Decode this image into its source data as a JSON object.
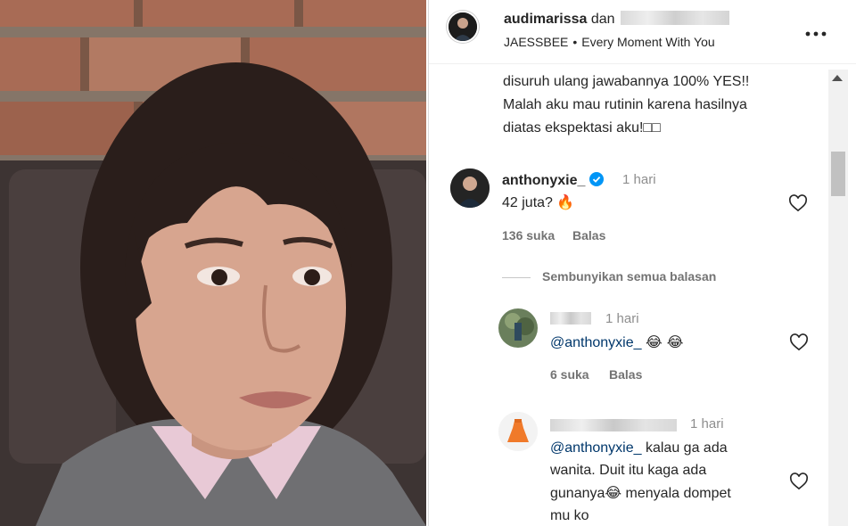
{
  "post": {
    "author": "audimarissa",
    "connector": "dan",
    "subtitle_left": "JAESSBEE",
    "subtitle_sep": "•",
    "subtitle_right": "Every Moment With You",
    "more_icon": "more-horizontal-icon"
  },
  "caption_lines": [
    "disuruh ulang jawabannya 100% YES!!",
    "Malah aku mau rutinin karena hasilnya",
    "diatas ekspektasi aku!□□"
  ],
  "comment": {
    "username": "anthonyxie_",
    "verified_icon": "verified-badge-icon",
    "time": "1 hari",
    "text": "42 juta?",
    "emoji": "🔥",
    "likes": "136 suka",
    "reply_label": "Balas",
    "hide_replies": "Sembunyikan semua balasan"
  },
  "replies": [
    {
      "time": "1 hari",
      "mention": "@anthonyxie_",
      "text": "",
      "emoji": "😂 😂",
      "likes": "6 suka",
      "reply_label": "Balas"
    },
    {
      "time": "1 hari",
      "mention": "@anthonyxie_",
      "lines": [
        " kalau ga ada",
        "wanita. Duit itu kaga ada",
        "gunanya",
        " menyala dompet",
        "mu ko"
      ],
      "emoji": "😂"
    }
  ],
  "colors": {
    "text": "#262626",
    "muted": "#8e8e8e",
    "mention": "#00376b",
    "verified": "#0095f6",
    "divider": "#dbdbdb"
  }
}
